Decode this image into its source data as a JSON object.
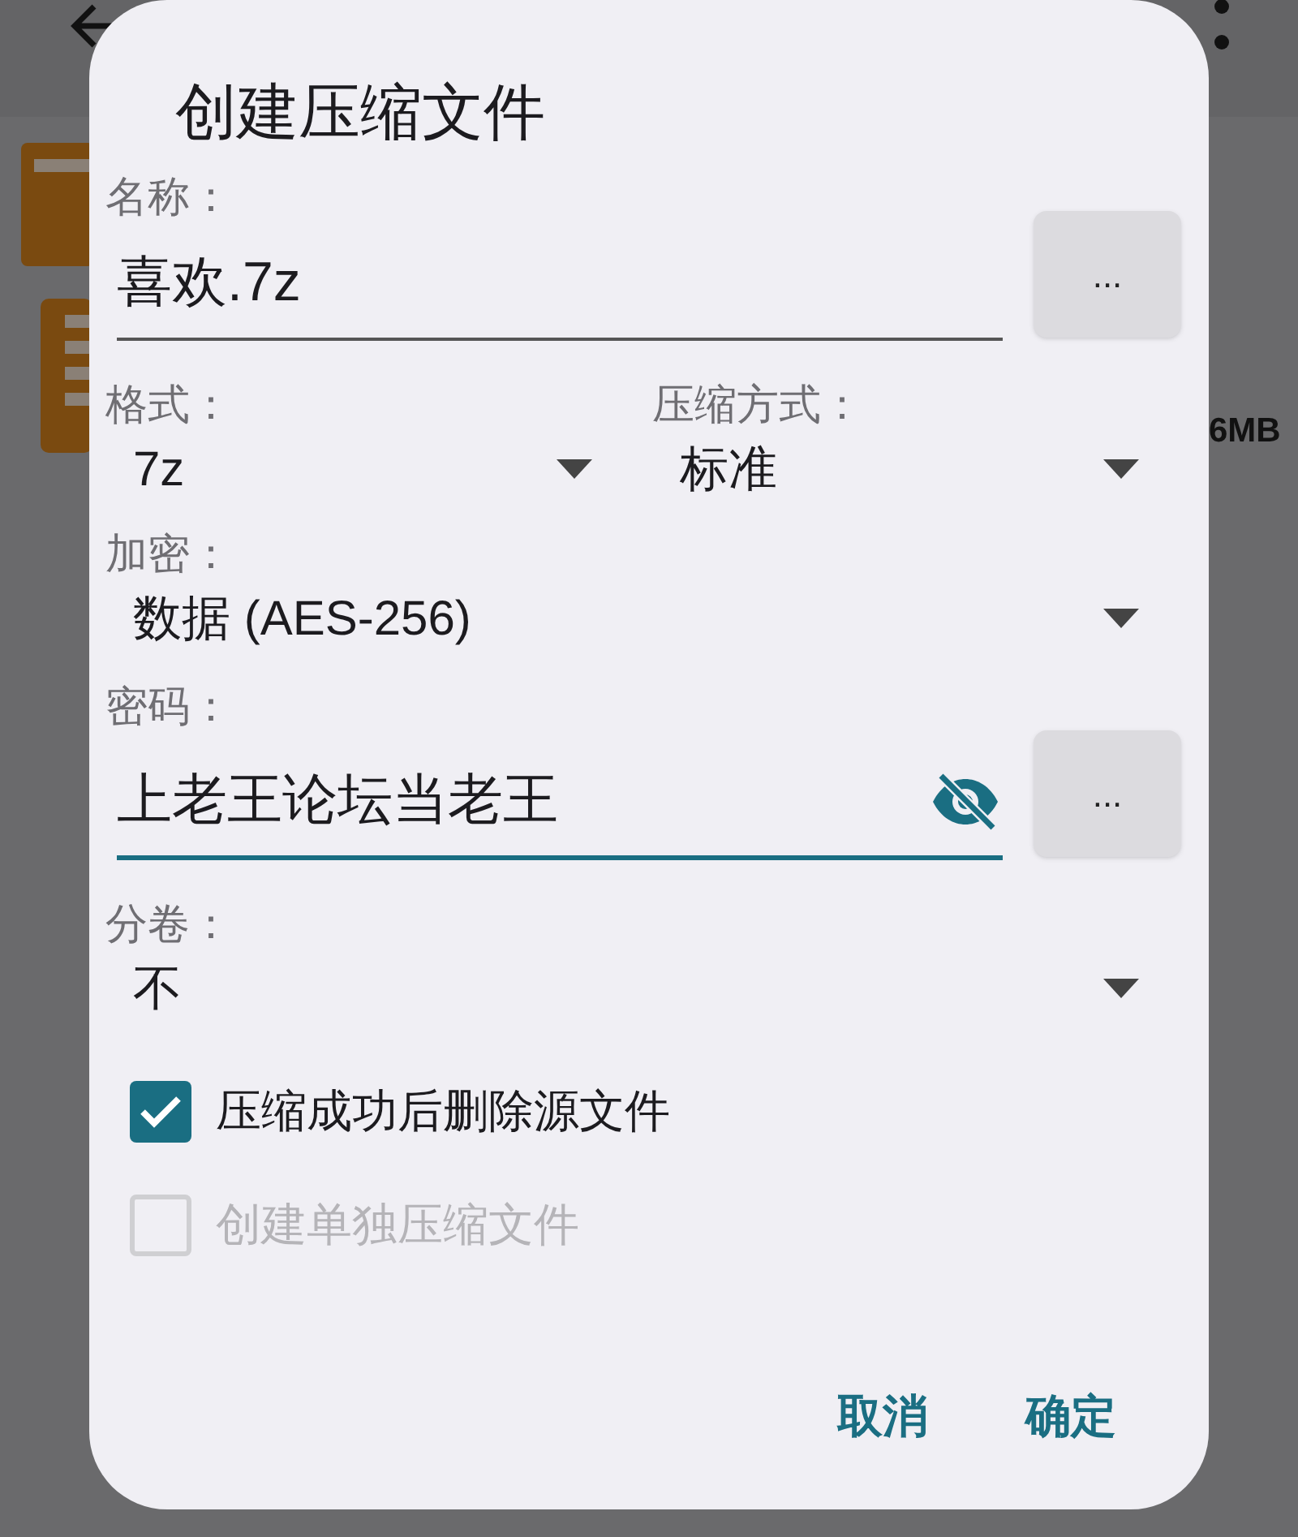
{
  "background": {
    "size_text": "6MB"
  },
  "dialog": {
    "title": "创建压缩文件",
    "name": {
      "label": "名称：",
      "value": "喜欢.7z",
      "browse": "..."
    },
    "format": {
      "label": "格式：",
      "value": "7z"
    },
    "method": {
      "label": "压缩方式：",
      "value": "标准"
    },
    "encryption": {
      "label": "加密：",
      "value": "数据 (AES-256)"
    },
    "password": {
      "label": "密码：",
      "value": "上老王论坛当老王",
      "browse": "...",
      "focused": true
    },
    "volumes": {
      "label": "分卷：",
      "value": "不"
    },
    "options": [
      {
        "label": "压缩成功后删除源文件",
        "checked": true,
        "disabled": false
      },
      {
        "label": "创建单独压缩文件",
        "checked": false,
        "disabled": true
      }
    ],
    "buttons": [
      "取消",
      "确定"
    ]
  }
}
